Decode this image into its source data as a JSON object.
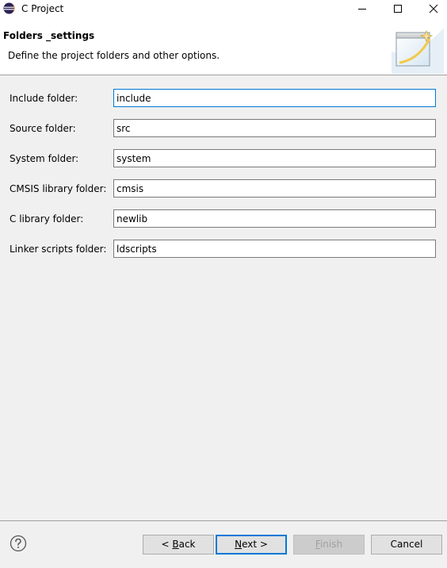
{
  "window": {
    "title": "C Project"
  },
  "banner": {
    "title": "Folders _settings",
    "description": "Define the project folders and other options."
  },
  "fields": [
    {
      "label": "Include folder:",
      "value": "include",
      "focused": true
    },
    {
      "label": "Source folder:",
      "value": "src",
      "focused": false
    },
    {
      "label": "System folder:",
      "value": "system",
      "focused": false
    },
    {
      "label": "CMSIS library folder:",
      "value": "cmsis",
      "focused": false
    },
    {
      "label": "C library folder:",
      "value": "newlib",
      "focused": false
    },
    {
      "label": "Linker scripts folder:",
      "value": "ldscripts",
      "focused": false
    }
  ],
  "buttons": {
    "back": {
      "prefix": "< ",
      "mnemonic": "B",
      "rest": "ack"
    },
    "next": {
      "prefix": "",
      "mnemonic": "N",
      "rest": "ext >"
    },
    "finish": {
      "prefix": "",
      "mnemonic": "F",
      "rest": "inish",
      "enabled": false
    },
    "cancel": {
      "label": "Cancel"
    }
  },
  "colors": {
    "accent": "#0078d7",
    "eclipse_purple": "#2c2255"
  },
  "icons": {
    "app": "eclipse-icon",
    "help": "help-icon",
    "banner": "wizard-banner-icon"
  }
}
